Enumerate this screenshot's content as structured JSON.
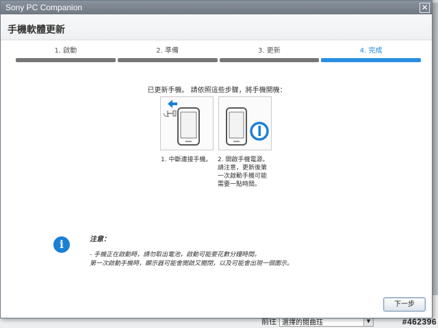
{
  "window": {
    "title": "Sony PC Companion",
    "close_symbol": "✕"
  },
  "header": {
    "title": "手機軟體更新"
  },
  "steps": [
    {
      "label": "1. 啟動",
      "status": "done"
    },
    {
      "label": "2. 準備",
      "status": "done"
    },
    {
      "label": "3. 更新",
      "status": "done"
    },
    {
      "label": "4. 完成",
      "status": "active"
    }
  ],
  "instruction": "已更新手機。 請依照這些步驟，將手機開機：",
  "cards": [
    {
      "caption": "1. 中斷連接手機。",
      "icon": "phone-disconnect-icon"
    },
    {
      "caption": "2. 開啟手機電源。\n請注意，更新後第\n一次啟動手機可能\n需要一點時間。",
      "icon": "phone-power-icon"
    }
  ],
  "note": {
    "title": "注意：",
    "lines": [
      "- 手機正在啟動時，請勿取出電池，啟動可能要花數分鐘時間。",
      "第一次啟動手機時，顯示器可能會開啟又關閉，以及可能會出現一個圖示。"
    ]
  },
  "buttons": {
    "next": "下一步"
  },
  "background": {
    "field_label": "前往",
    "field_value": "選擇的閱曲珏",
    "watermark": "#462396"
  },
  "colors": {
    "accent": "#2a8fe4",
    "info": "#1a7fd6",
    "step_inactive": "#747678"
  }
}
